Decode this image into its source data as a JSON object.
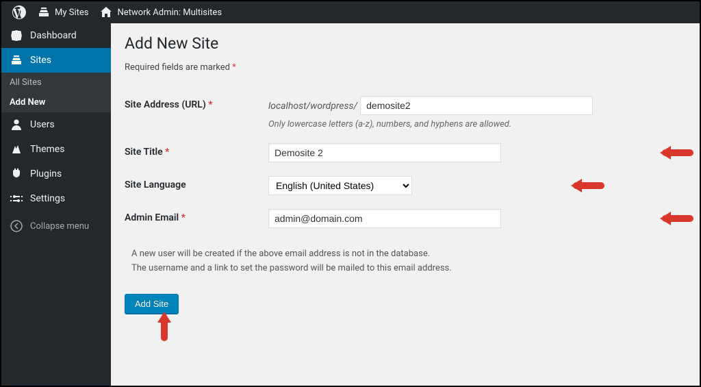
{
  "toolbar": {
    "my_sites": "My Sites",
    "network_admin": "Network Admin: Multisites"
  },
  "sidebar": {
    "items": [
      {
        "label": "Dashboard"
      },
      {
        "label": "Sites"
      },
      {
        "label": "Users"
      },
      {
        "label": "Themes"
      },
      {
        "label": "Plugins"
      },
      {
        "label": "Settings"
      }
    ],
    "submenu": {
      "all_sites": "All Sites",
      "add_new": "Add New"
    },
    "collapse": "Collapse menu"
  },
  "page": {
    "title": "Add New Site",
    "required_note": "Required fields are marked ",
    "form": {
      "site_address": {
        "label": "Site Address (URL) ",
        "prefix": "localhost/wordpress/",
        "value": "demosite2",
        "help": "Only lowercase letters (a-z), numbers, and hyphens are allowed."
      },
      "site_title": {
        "label": "Site Title ",
        "value": "Demosite 2"
      },
      "site_language": {
        "label": "Site Language",
        "value": "English (United States)"
      },
      "admin_email": {
        "label": "Admin Email ",
        "value": "admin@domain.com"
      }
    },
    "info_line1": "A new user will be created if the above email address is not in the database.",
    "info_line2": "The username and a link to set the password will be mailed to this email address.",
    "submit_label": "Add Site"
  }
}
